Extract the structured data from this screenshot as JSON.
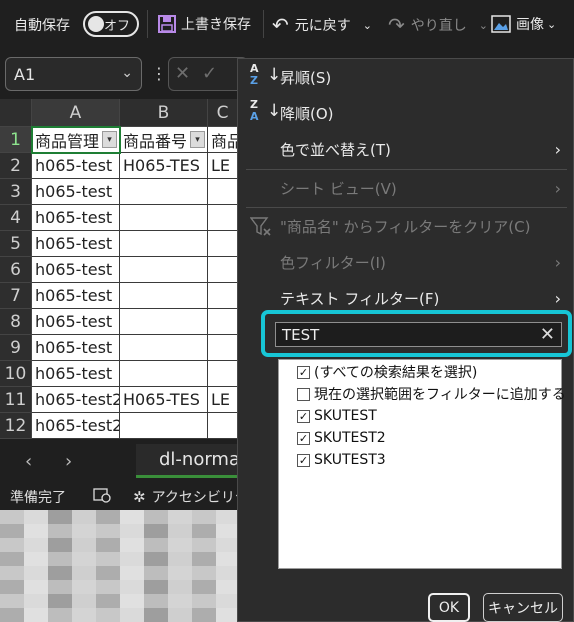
{
  "quick_access": {
    "autosave_label": "自動保存",
    "autosave_state": "オフ",
    "save_label": "上書き保存",
    "undo_label": "元に戻す",
    "redo_label": "やり直し",
    "image_label": "画像"
  },
  "formula_bar": {
    "name_box": "A1"
  },
  "grid": {
    "columns": [
      "A",
      "B",
      "C"
    ],
    "rows": [
      [
        "1",
        "商品管理",
        "商品番号",
        "商品"
      ],
      [
        "2",
        "h065-test",
        "H065-TES",
        "LE"
      ],
      [
        "3",
        "h065-test",
        "",
        ""
      ],
      [
        "4",
        "h065-test",
        "",
        ""
      ],
      [
        "5",
        "h065-test",
        "",
        ""
      ],
      [
        "6",
        "h065-test",
        "",
        ""
      ],
      [
        "7",
        "h065-test",
        "",
        ""
      ],
      [
        "8",
        "h065-test",
        "",
        ""
      ],
      [
        "9",
        "h065-test",
        "",
        ""
      ],
      [
        "10",
        "h065-test",
        "",
        ""
      ],
      [
        "11",
        "h065-test2",
        "H065-TES",
        "LE"
      ],
      [
        "12",
        "h065-test2",
        "",
        ""
      ]
    ]
  },
  "sheet_tab": "dl-norma",
  "status": {
    "ready": "準備完了",
    "accessibility": "アクセシビリテ"
  },
  "filter_menu": {
    "sort_asc": "昇順(S)",
    "sort_desc": "降順(O)",
    "sort_by_color": "色で並べ替え(T)",
    "sheet_view": "シート ビュー(V)",
    "clear_filter": "\"商品名\" からフィルターをクリア(C)",
    "color_filter": "色フィルター(I)",
    "text_filter": "テキスト フィルター(F)",
    "search_value": "TEST",
    "list_items": [
      {
        "label": "(すべての検索結果を選択)",
        "checked": true
      },
      {
        "label": "現在の選択範囲をフィルターに追加する",
        "checked": false
      },
      {
        "label": "SKUTEST",
        "checked": true
      },
      {
        "label": "SKUTEST2",
        "checked": true
      },
      {
        "label": "SKUTEST3",
        "checked": true
      }
    ],
    "ok_label": "OK",
    "cancel_label": "キャンセル"
  },
  "colors": {
    "accent_highlight": "#17c6d6",
    "selected_row_header": "#8ee48e",
    "sort_icon_blue": "#5aa0e6"
  }
}
